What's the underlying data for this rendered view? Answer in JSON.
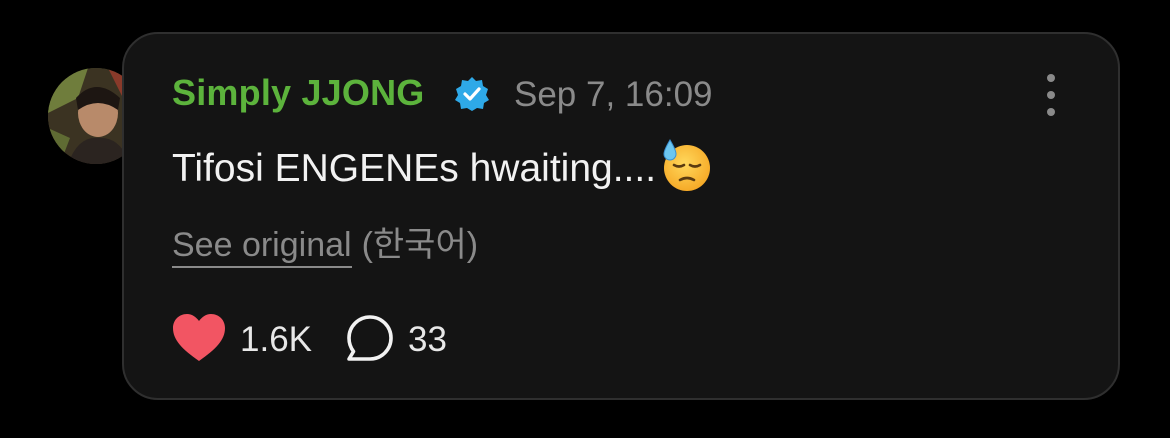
{
  "post": {
    "author": "Simply JJONG",
    "verified_icon": "verified-badge-icon",
    "timestamp": "Sep 7, 16:09",
    "text": "Tifosi ENGENEs hwaiting....",
    "emoji": "downcast-face-with-sweat-emoji",
    "see_original_label": "See original",
    "original_language": "(한국어)",
    "like_count": "1.6K",
    "comment_count": "33"
  },
  "colors": {
    "background": "#000000",
    "card_bg": "#141414",
    "card_border": "#2f2f2f",
    "author": "#5cb33c",
    "verified": "#2ea9e8",
    "muted": "#8a8a8a",
    "text": "#f2f2f2",
    "heart": "#f25563"
  },
  "icons": {
    "more": "more-vertical-icon",
    "like": "heart-icon",
    "comment": "comment-bubble-icon"
  }
}
